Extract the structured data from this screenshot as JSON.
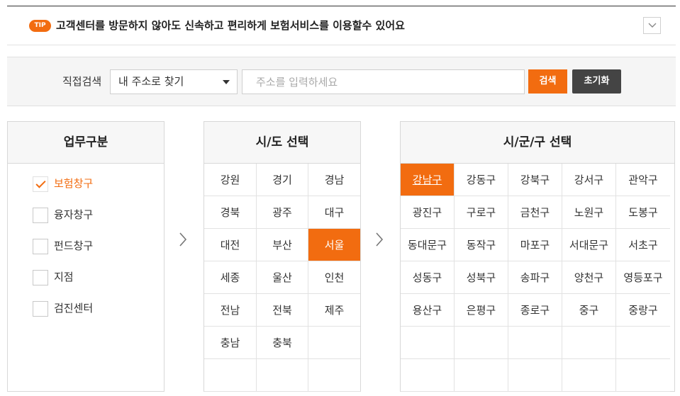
{
  "tip": {
    "badge": "TIP",
    "text": "고객센터를 방문하지 않아도 신속하고 편리하게 보험서비스를 이용할수 있어요"
  },
  "search": {
    "label": "직접검색",
    "select_value": "내 주소로 찾기",
    "placeholder": "주소를 입력하세요",
    "value": "",
    "search_button": "검색",
    "reset_button": "초기화"
  },
  "business": {
    "title": "업무구분",
    "items": [
      {
        "label": "보험창구",
        "checked": true
      },
      {
        "label": "융자창구",
        "checked": false
      },
      {
        "label": "펀드창구",
        "checked": false
      },
      {
        "label": "지점",
        "checked": false
      },
      {
        "label": "검진센터",
        "checked": false
      }
    ]
  },
  "province": {
    "title": "시/도 선택",
    "items": [
      "강원",
      "경기",
      "경남",
      "경북",
      "광주",
      "대구",
      "대전",
      "부산",
      "서울",
      "세종",
      "울산",
      "인천",
      "전남",
      "전북",
      "제주",
      "충남",
      "충북"
    ],
    "selected": "서울"
  },
  "district": {
    "title": "시/군/구 선택",
    "items": [
      "강남구",
      "강동구",
      "강북구",
      "강서구",
      "관악구",
      "광진구",
      "구로구",
      "금천구",
      "노원구",
      "도봉구",
      "동대문구",
      "동작구",
      "마포구",
      "서대문구",
      "서초구",
      "성동구",
      "성북구",
      "송파구",
      "양천구",
      "영등포구",
      "용산구",
      "은평구",
      "종로구",
      "중구",
      "중랑구"
    ],
    "selected": "강남구"
  },
  "colors": {
    "accent": "#f26c10",
    "dark_button": "#444444"
  }
}
